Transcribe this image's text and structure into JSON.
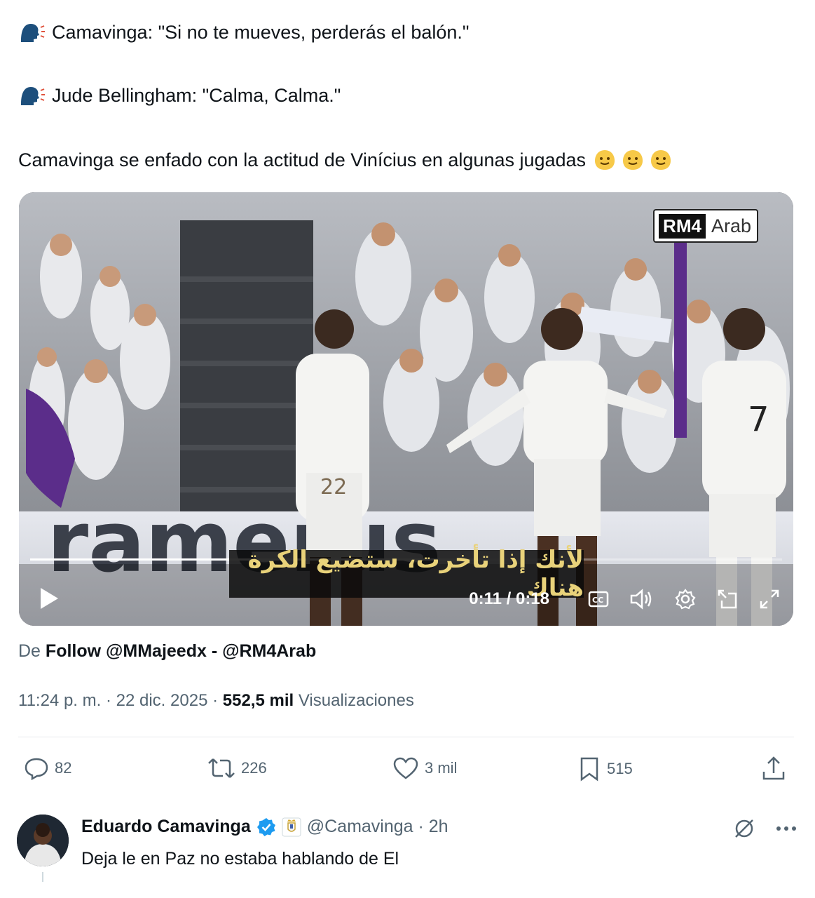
{
  "tweet": {
    "line1": "Camavinga: \"Si no te mueves, perderás el balón.\"",
    "line2": "Jude Bellingham: \"Calma, Calma.\"",
    "line3": "Camavinga se enfado con la actitud de Vinícius en algunas jugadas",
    "line_icons": [
      "speaking-head-icon",
      "speaking-head-icon"
    ],
    "trailing_emoji": [
      "smile-emoji-icon",
      "smile-emoji-icon",
      "smile-emoji-icon"
    ]
  },
  "video": {
    "watermark_brand": "RM4",
    "watermark_suffix": "Arab",
    "subtitle": "لأنك إذا تأخرت، ستضيع الكرة هناك",
    "time": "0:11 / 0:18",
    "progress": 0.61,
    "controls": [
      "play-icon",
      "captions-icon",
      "volume-icon",
      "settings-icon",
      "pip-icon",
      "fullscreen-icon"
    ]
  },
  "source": {
    "prefix": "De",
    "name": "Follow @MMajeedx - @RM4Arab"
  },
  "meta": {
    "time": "11:24 p. m.",
    "date": "22 dic. 2025",
    "views_count": "552,5 mil",
    "views_label": "Visualizaciones"
  },
  "actions": {
    "replies": "82",
    "reposts": "226",
    "likes": "3 mil",
    "bookmarks": "515"
  },
  "reply": {
    "name": "Eduardo Camavinga",
    "handle": "@Camavinga · 2h",
    "text": "Deja le en Paz no estaba hablando de El"
  }
}
